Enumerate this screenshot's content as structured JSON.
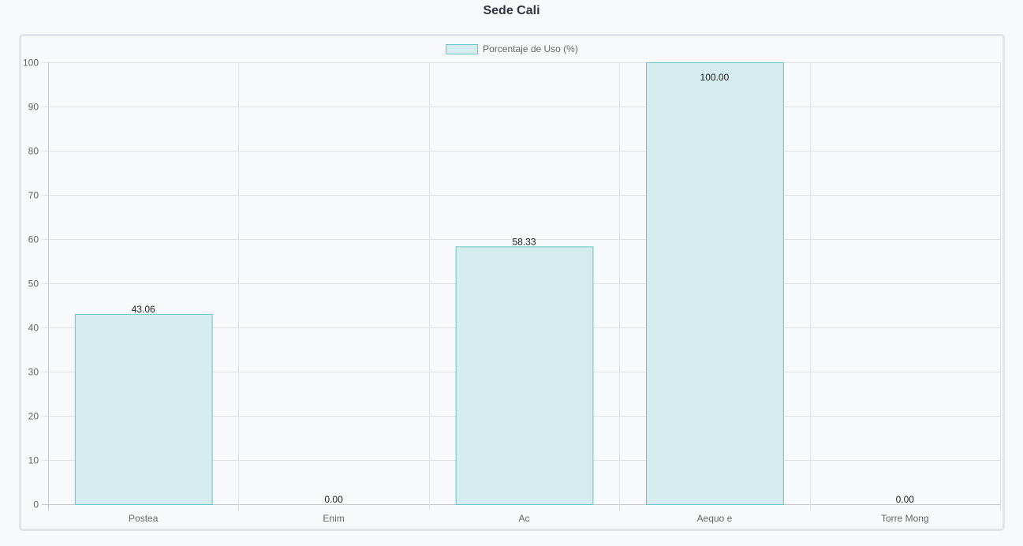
{
  "header": {
    "title": "Sede Cali"
  },
  "colors": {
    "bar_fill": "#d4ecee",
    "bar_stroke": "#6cc4c8",
    "grid": "#e2e2e2",
    "axis": "#c8c8c8",
    "tick_text": "#666666",
    "data_label_text": "#222222"
  },
  "chart_data": {
    "type": "bar",
    "title": "Sede Cali",
    "categories": [
      "Postea",
      "Enim",
      "Ac",
      "Aequo e",
      "Torre Mong"
    ],
    "series": [
      {
        "name": "Porcentaje de Uso (%)",
        "values": [
          43.06,
          0.0,
          58.33,
          100.0,
          0.0
        ],
        "labels": [
          "43.06",
          "0.00",
          "58.33",
          "100.00",
          "0.00"
        ]
      }
    ],
    "ylim": [
      0,
      100
    ],
    "yticks": [
      "0",
      "10",
      "20",
      "30",
      "40",
      "50",
      "60",
      "70",
      "80",
      "90",
      "100"
    ],
    "xlabel": "",
    "ylabel": "",
    "grid": true,
    "legend_position": "top-center"
  }
}
